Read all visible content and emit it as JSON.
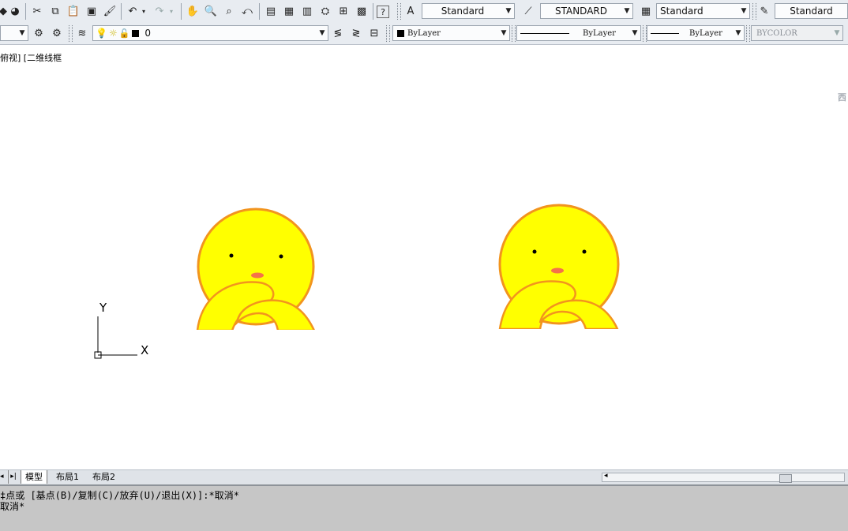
{
  "toolbar_row1": {
    "text_style": "Standard",
    "dim_style": "STANDARD",
    "table_style": "Standard",
    "multileader_style": "Standard"
  },
  "toolbar_row2": {
    "layer": "0",
    "color": "ByLayer",
    "linetype": "ByLayer",
    "lineweight": "ByLayer",
    "plotstyle": "BYCOLOR"
  },
  "viewport": {
    "label": "俯视] [二维线框",
    "viewcube_label": "西"
  },
  "ucs": {
    "y_label": "Y",
    "x_label": "X"
  },
  "tabs": [
    "模型",
    "布局1",
    "布局2"
  ],
  "command": {
    "line1": "‡点或 [基点(B)/复制(C)/放弃(U)/退出(X)]:*取消*",
    "line2": "取消*"
  },
  "colors": {
    "face_fill": "#ffff00",
    "face_outline": "#f2941e",
    "nose": "#f4734a",
    "background": "#ffffff"
  }
}
